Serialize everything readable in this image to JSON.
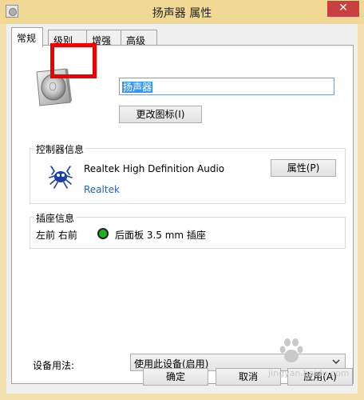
{
  "window": {
    "title": "扬声器 属性",
    "close_glyph": "✕"
  },
  "tabs": [
    {
      "label": "常规",
      "active": true
    },
    {
      "label": "级别",
      "active": false
    },
    {
      "label": "增强",
      "active": false
    },
    {
      "label": "高级",
      "active": false
    }
  ],
  "device": {
    "name": "扬声器",
    "change_icon_label": "更改图标(I)"
  },
  "controller": {
    "group_label": "控制器信息",
    "name": "Realtek High Definition Audio",
    "vendor": "Realtek",
    "properties_label": "属性(P)"
  },
  "jack": {
    "group_label": "插座信息",
    "position": "左前 右前",
    "description": "后面板 3.5 mm 插座",
    "color": "#1db31d"
  },
  "usage": {
    "label": "设备用法:",
    "selected": "使用此设备(启用)"
  },
  "buttons": {
    "ok": "确定",
    "cancel": "取消",
    "apply": "应用(A)"
  },
  "watermark": {
    "text": "jingyan.baidu.com"
  },
  "colors": {
    "highlight": "#ee0000",
    "titlebar": "#f1d995",
    "close": "#c8403f"
  }
}
